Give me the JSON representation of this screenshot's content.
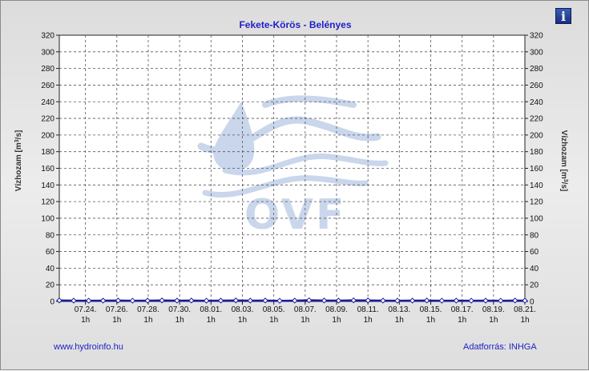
{
  "chart_data": {
    "type": "line",
    "title": "Fekete-Körös - Belényes",
    "ylabel_left": "Vízhozam [m3/s]",
    "ylabel_right": "Vízhozam [m3/s]",
    "ylim": [
      0,
      320
    ],
    "yticks": [
      0,
      20,
      40,
      60,
      80,
      100,
      120,
      140,
      160,
      180,
      200,
      220,
      240,
      260,
      280,
      300,
      320
    ],
    "xlim": [
      "07.22. 9h",
      "08.21. 1h"
    ],
    "xticks": [
      {
        "date": "07.24.",
        "hour": "1h"
      },
      {
        "date": "07.26.",
        "hour": "1h"
      },
      {
        "date": "07.28.",
        "hour": "1h"
      },
      {
        "date": "07.30.",
        "hour": "1h"
      },
      {
        "date": "08.01.",
        "hour": "1h"
      },
      {
        "date": "08.03.",
        "hour": "1h"
      },
      {
        "date": "08.05.",
        "hour": "1h"
      },
      {
        "date": "08.07.",
        "hour": "1h"
      },
      {
        "date": "08.09.",
        "hour": "1h"
      },
      {
        "date": "08.11.",
        "hour": "1h"
      },
      {
        "date": "08.13.",
        "hour": "1h"
      },
      {
        "date": "08.15.",
        "hour": "1h"
      },
      {
        "date": "08.17.",
        "hour": "1h"
      },
      {
        "date": "08.19.",
        "hour": "1h"
      },
      {
        "date": "08.21.",
        "hour": "1h"
      }
    ],
    "grid": true,
    "series": [
      {
        "color": "#1a1aa0",
        "x": [
          "07.22. 9h",
          "07.23. 7h",
          "07.24. 6h",
          "07.25. 4h",
          "07.26. 3h",
          "07.27. 1h",
          "07.28. 0h",
          "07.28. 22h",
          "07.29. 21h",
          "07.30. 19h",
          "07.31. 18h",
          "08.01. 16h",
          "08.02. 15h",
          "08.03. 13h",
          "08.04. 12h",
          "08.05. 10h",
          "08.06. 9h",
          "08.07. 7h",
          "08.08. 6h",
          "08.09. 4h",
          "08.10. 3h",
          "08.11. 1h",
          "08.12. 0h",
          "08.12. 22h",
          "08.13. 21h",
          "08.14. 19h",
          "08.15. 18h",
          "08.16. 16h",
          "08.17. 15h",
          "08.18. 13h",
          "08.19. 12h",
          "08.20. 10h",
          "08.21. 1h"
        ],
        "values": [
          1.2,
          1.0,
          0.9,
          1.0,
          1.1,
          0.9,
          1.0,
          1.2,
          1.0,
          1.1,
          0.9,
          1.0,
          1.2,
          1.0,
          1.1,
          0.8,
          1.0,
          1.4,
          1.1,
          1.0,
          1.3,
          1.2,
          1.0,
          0.9,
          1.0,
          1.1,
          0.9,
          1.0,
          0.9,
          1.0,
          0.9,
          1.1,
          1.0
        ]
      }
    ]
  },
  "footer": {
    "left": "www.hydroinfo.hu",
    "right": "Adatforrás: INHGA"
  },
  "watermark": {
    "text": "OVF"
  },
  "info_button": {
    "label": "i"
  },
  "colors": {
    "title": "#1e1ec8",
    "series": "#1a1aa0",
    "grid": "#555555",
    "watermark": "#c9d6ec"
  }
}
